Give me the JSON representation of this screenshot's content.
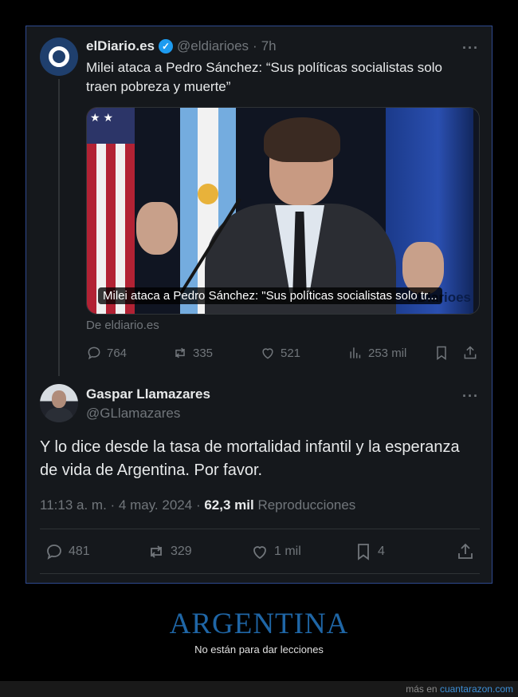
{
  "quoted_tweet": {
    "author_name": "elDiario.es",
    "verified_glyph": "✓",
    "handle": "@eldiarioes",
    "separator": "·",
    "age": "7h",
    "more_glyph": "···",
    "text": "Milei ataca a Pedro Sánchez: “Sus políticas socialistas solo traen pobreza y muerte”",
    "media_caption": "Milei ataca a Pedro Sánchez: \"Sus políticas socialistas solo tr...",
    "media_watermark": "elDiarioes",
    "link_source": "De eldiario.es",
    "stats": {
      "replies": "764",
      "reposts": "335",
      "likes": "521",
      "views": "253 mil"
    }
  },
  "reply_tweet": {
    "author_name": "Gaspar Llamazares",
    "handle": "@GLlamazares",
    "more_glyph": "···",
    "text": "Y lo dice desde la tasa de mortalidad infantil y la esperanza de vida de Argentina. Por favor.",
    "timestamp": "11:13 a. m. · 4 may. 2024",
    "meta_separator": "·",
    "views_count": "62,3 mil",
    "views_label": "Reproducciones",
    "stats": {
      "replies": "481",
      "reposts": "329",
      "likes": "1 mil",
      "bookmarks": "4"
    }
  },
  "footer": {
    "title": "ARGENTINA",
    "subtitle": "No están para dar lecciones",
    "more_prefix": "más en",
    "site": "cuantarazon.com"
  },
  "colors": {
    "accent_blue": "#1d9bf0",
    "title_blue": "#1f66a6",
    "card_bg": "#15181c",
    "card_border": "#2f4a8f"
  },
  "icons": [
    "reply-icon",
    "repost-icon",
    "like-icon",
    "views-icon",
    "bookmark-icon",
    "share-icon",
    "verified-badge-icon",
    "more-icon"
  ]
}
